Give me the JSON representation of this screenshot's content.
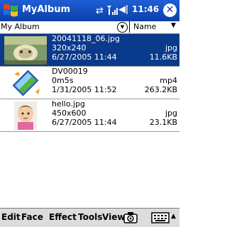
{
  "titlebar": {
    "title": "MyAlbum",
    "clock": "11:46",
    "close_label": "✕",
    "icons": [
      "windows-start-icon",
      "sync-icon",
      "signal-icon",
      "volume-icon"
    ]
  },
  "toolbar": {
    "album": "My Album",
    "album_dropdown_icon": "chevron-down-circle-icon",
    "sort": "Name",
    "sort_dropdown_icon": "triangle-down-icon"
  },
  "items": [
    {
      "name": "20041118_06.jpg",
      "dims": "320x240",
      "type": "jpg",
      "date": "6/27/2005 11:44",
      "size": "11.6KB",
      "selected": true
    },
    {
      "name": "DV00019",
      "dims": "0m5s",
      "type": "mp4",
      "date": "1/31/2005 11:52",
      "size": "263.2KB",
      "selected": false
    },
    {
      "name": "hello.jpg",
      "dims": "450x600",
      "type": "jpg",
      "date": "6/27/2005 11:44",
      "size": "23.1KB",
      "selected": false
    }
  ],
  "menu": [
    "Edit",
    "Face",
    "Effect",
    "Tools",
    "View"
  ],
  "colors": {
    "titlebar": "#0b3fa9",
    "selection": "#0a3a8c",
    "menubar": "#dcdcdc"
  }
}
